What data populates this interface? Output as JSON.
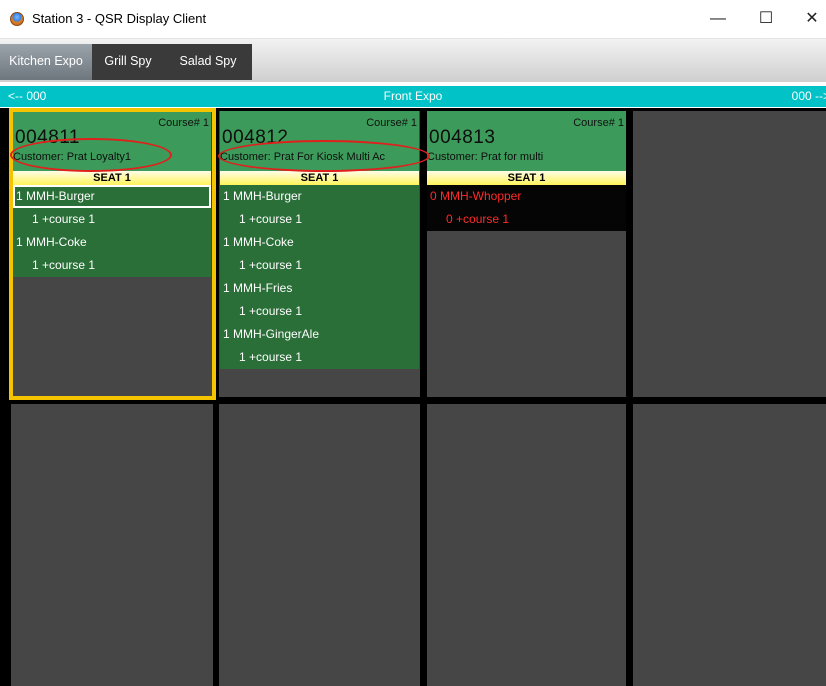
{
  "window": {
    "title": "Station 3 - QSR Display Client",
    "minimize_glyph": "—",
    "maximize_glyph": "☐",
    "close_glyph": "✕"
  },
  "tabs": [
    {
      "label": "Kitchen Expo",
      "active": true
    },
    {
      "label": "Grill Spy",
      "active": false
    },
    {
      "label": "Salad Spy",
      "active": false
    }
  ],
  "expo_bar": {
    "left": "<-- 000",
    "title": "Front Expo",
    "right": "000 -->"
  },
  "orders": [
    {
      "number": "004811",
      "course": "Course# 1",
      "customer": "Customer: Prat Loyalty1",
      "seat": "SEAT 1",
      "items": [
        "1 MMH-Burger",
        "1 +course 1",
        "1 MMH-Coke",
        "1 +course 1"
      ]
    },
    {
      "number": "004812",
      "course": "Course# 1",
      "customer": "Customer: Prat For Kiosk Multi Ac",
      "seat": "SEAT 1",
      "items": [
        "1 MMH-Burger",
        "1 +course 1",
        "1 MMH-Coke",
        "1 +course 1",
        "1 MMH-Fries",
        "1 +course 1",
        "1 MMH-GingerAle",
        "1 +course 1"
      ]
    },
    {
      "number": "004813",
      "course": "Course# 1",
      "customer": "Customer: Prat for multi",
      "seat": "SEAT 1",
      "items": [
        "0 MMH-Whopper",
        "0 +course 1"
      ]
    }
  ],
  "colors": {
    "accent_cyan": "#00c2c7",
    "order_green": "#3c9b5a",
    "items_green": "#2a6e38",
    "selection_yellow": "#f5c400",
    "voided_red": "#ff2a2a",
    "annotation_red": "#e0201c"
  }
}
